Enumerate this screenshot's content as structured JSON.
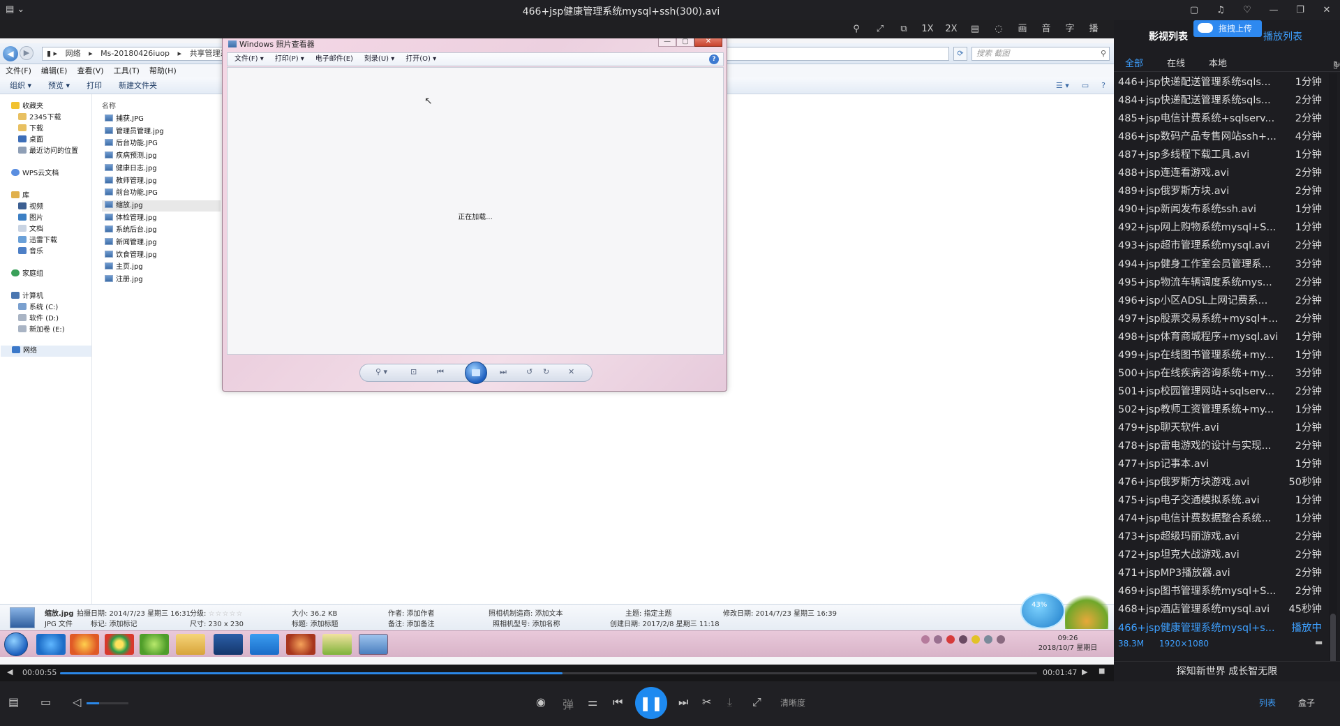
{
  "player": {
    "title": "466+jsp健康管理系统mysql+ssh(300).avi",
    "toolbar": [
      "1X",
      "2X",
      "画",
      "音",
      "字",
      "播"
    ],
    "progress": {
      "current": "00:00:55",
      "total": "00:01:47",
      "fraction": 0.514
    },
    "volume_fraction": 0.3,
    "controls": {
      "hd_label": "清晰度",
      "tab_list": "列表",
      "tab_box": "盒子",
      "danmu": "弹"
    }
  },
  "explorer": {
    "breadcrumb": [
      "网络",
      "Ms-20180426iuop",
      "共享管理系统"
    ],
    "search_placeholder": "搜索 截图",
    "menu": [
      "文件(F)",
      "编辑(E)",
      "查看(V)",
      "工具(T)",
      "帮助(H)"
    ],
    "commands": [
      "组织 ▾",
      "预览 ▾",
      "打印",
      "新建文件夹"
    ],
    "sidebar": {
      "favorites": "收藏夹",
      "fav_items": [
        "2345下载",
        "下载",
        "桌面",
        "最近访问的位置"
      ],
      "wps": "WPS云文档",
      "library": "库",
      "lib_items": [
        "视频",
        "图片",
        "文档",
        "迅雷下载",
        "音乐"
      ],
      "homegroup": "家庭组",
      "computer": "计算机",
      "drives": [
        "系统 (C:)",
        "软件 (D:)",
        "新加卷 (E:)"
      ],
      "network": "网络"
    },
    "column_name": "名称",
    "files": [
      "捕获.JPG",
      "管理员管理.jpg",
      "后台功能.JPG",
      "疾病预测.jpg",
      "健康日志.jpg",
      "教师管理.jpg",
      "前台功能.JPG",
      "缩放.jpg",
      "体检管理.jpg",
      "系统后台.jpg",
      "新闻管理.jpg",
      "饮食管理.jpg",
      "主页.jpg",
      "注册.jpg"
    ],
    "selected_file_index": 7,
    "details": {
      "filename": "缩放.jpg",
      "filetype": "JPG 文件",
      "shot_date": "拍摄日期: 2014/7/23 星期三 16:31",
      "rating": "分级:",
      "tags": "标记: 添加标记",
      "size": "大小: 36.2 KB",
      "dims": "尺寸: 230 x 230",
      "title": "标题: 添加标题",
      "author": "作者: 添加作者",
      "note": "备注: 添加备注",
      "camera_maker": "照相机制造商: 添加文本",
      "camera_model": "照相机型号: 添加名称",
      "subject": "主题: 指定主题",
      "created": "创建日期: 2017/2/8 星期三 11:18",
      "modified": "修改日期: 2014/7/23 星期三 16:39"
    }
  },
  "photo_viewer": {
    "title": "Windows 照片查看器",
    "menu": [
      "文件(F) ▾",
      "打印(P) ▾",
      "电子邮件(E)",
      "刻录(U) ▾",
      "打开(O) ▾"
    ],
    "loading": "正在加载..."
  },
  "taskbar": {
    "clock_time": "09:26",
    "clock_date": "2018/10/7 星期日",
    "widget_pct": "43%"
  },
  "playlist": {
    "title": "影视列表",
    "upload": "拖拽上传",
    "play_list": "播放列表",
    "tabs": [
      "全部",
      "在线",
      "本地"
    ],
    "items": [
      {
        "name": "446+jsp快递配送管理系统sqls...",
        "dur": "1分钟"
      },
      {
        "name": "484+jsp快递配送管理系统sqls...",
        "dur": "2分钟"
      },
      {
        "name": "485+jsp电信计费系统+sqlserv...",
        "dur": "2分钟"
      },
      {
        "name": "486+jsp数码产品专售网站ssh+...",
        "dur": "4分钟"
      },
      {
        "name": "487+jsp多线程下载工具.avi",
        "dur": "1分钟"
      },
      {
        "name": "488+jsp连连看游戏.avi",
        "dur": "2分钟"
      },
      {
        "name": "489+jsp俄罗斯方块.avi",
        "dur": "2分钟"
      },
      {
        "name": "490+jsp新闻发布系统ssh.avi",
        "dur": "1分钟"
      },
      {
        "name": "492+jsp网上购物系统mysql+S...",
        "dur": "1分钟"
      },
      {
        "name": "493+jsp超市管理系统mysql.avi",
        "dur": "2分钟"
      },
      {
        "name": "494+jsp健身工作室会员管理系...",
        "dur": "3分钟"
      },
      {
        "name": "495+jsp物流车辆调度系统mys...",
        "dur": "2分钟"
      },
      {
        "name": "496+jsp小区ADSL上网记费系...",
        "dur": "2分钟"
      },
      {
        "name": "497+jsp股票交易系统+mysql+...",
        "dur": "2分钟"
      },
      {
        "name": "498+jsp体育商城程序+mysql.avi",
        "dur": "1分钟"
      },
      {
        "name": "499+jsp在线图书管理系统+my...",
        "dur": "1分钟"
      },
      {
        "name": "500+jsp在线疾病咨询系统+my...",
        "dur": "3分钟"
      },
      {
        "name": "501+jsp校园管理网站+sqlserv...",
        "dur": "2分钟"
      },
      {
        "name": "502+jsp教师工资管理系统+my...",
        "dur": "1分钟"
      },
      {
        "name": "479+jsp聊天软件.avi",
        "dur": "1分钟"
      },
      {
        "name": "478+jsp雷电游戏的设计与实现...",
        "dur": "2分钟"
      },
      {
        "name": "477+jsp记事本.avi",
        "dur": "1分钟"
      },
      {
        "name": "476+jsp俄罗斯方块游戏.avi",
        "dur": "50秒钟"
      },
      {
        "name": "475+jsp电子交通模拟系统.avi",
        "dur": "1分钟"
      },
      {
        "name": "474+jsp电信计费数据整合系统...",
        "dur": "1分钟"
      },
      {
        "name": "473+jsp超级玛丽游戏.avi",
        "dur": "2分钟"
      },
      {
        "name": "472+jsp坦克大战游戏.avi",
        "dur": "2分钟"
      },
      {
        "name": "471+jspMP3播放器.avi",
        "dur": "2分钟"
      },
      {
        "name": "469+jsp图书管理系统mysql+S...",
        "dur": "2分钟"
      },
      {
        "name": "468+jsp酒店管理系统mysql.avi",
        "dur": "45秒钟"
      },
      {
        "name": "466+jsp健康管理系统mysql+s...",
        "dur": "播放中"
      }
    ],
    "playing_index": 30,
    "meta_size": "38.3M",
    "meta_res": "1920×1080",
    "footer": "探知新世界 成长智无限"
  }
}
